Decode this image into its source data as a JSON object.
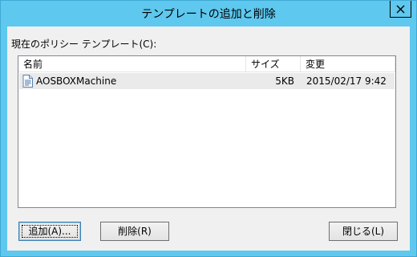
{
  "window": {
    "title": "テンプレートの追加と削除"
  },
  "list_label": "現在のポリシー テンプレート(C):",
  "list": {
    "columns": [
      "名前",
      "サイズ",
      "変更"
    ],
    "rows": [
      {
        "name": "AOSBOXMachine",
        "size": "5KB",
        "modified": "2015/02/17 9:42",
        "icon": "document-icon"
      }
    ]
  },
  "buttons": {
    "add": "追加(A)...",
    "remove": "削除(R)",
    "close": "閉じる(L)"
  },
  "colors": {
    "frame": "#5ec8ee",
    "client": "#f0f0f0",
    "row_selected": "#eaeaea"
  }
}
